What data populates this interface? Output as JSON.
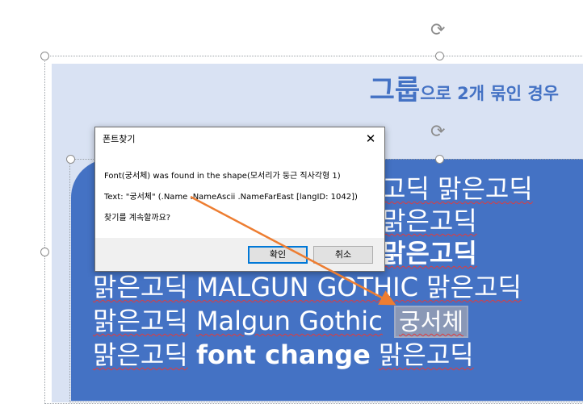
{
  "slide": {
    "group_title_big": "그룹",
    "group_title_small": "으로 2개 묶인 경우"
  },
  "lines": {
    "l1": "고딕 맑은고딕",
    "l2": "맑은고딕",
    "l3": "맑은고딕",
    "l4": "맑은고딕 MALGUN GOTHIC 맑은고딕",
    "l5_a": "맑은고딕",
    "l5_b": "Malgun Gothic",
    "l5_c": "궁서체",
    "l6_a": "맑은고딕",
    "l6_b": "font change",
    "l6_c": "맑은고딕"
  },
  "dialog": {
    "title": "폰트찾기",
    "close": "✕",
    "message1": "Font(궁서체) was found in the shape(모서리가 둥근 직사각형 1)",
    "message2": "Text: \"궁서체\" (.Name .NameAscii .NameFarEast [langID: 1042])",
    "message3": "찾기를 계속할까요?",
    "ok_label": "확인",
    "cancel_label": "취소"
  },
  "colors": {
    "shape_fill": "#4472c4",
    "group_fill": "#d9e2f3",
    "arrow": "#ed7d31"
  }
}
